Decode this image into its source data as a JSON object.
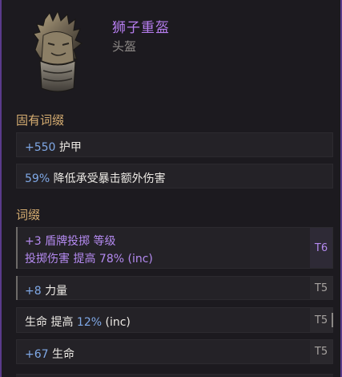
{
  "item": {
    "name": "狮子重盔",
    "type": "头盔",
    "icon": "lion-helmet-icon"
  },
  "implicit_section": {
    "title": "固有词缀",
    "rows": [
      {
        "num": "+550",
        "text": " 护甲"
      },
      {
        "num": "59%",
        "text": " 降低承受暴击额外伤害"
      }
    ]
  },
  "affix_section": {
    "title": "词缀",
    "rows": [
      {
        "line1": "+3 盾牌投掷 等级",
        "line2_a": "投掷伤害 提高 ",
        "line2_num": "78%",
        "line2_b": " (inc)",
        "tier": "T6"
      },
      {
        "num": "+8",
        "text": " 力量",
        "tier": "T5"
      },
      {
        "text_a": "生命 提高 ",
        "num": "12%",
        "text_b": " (inc)",
        "tier": "T5"
      },
      {
        "num": "+67",
        "text": " 生命",
        "tier": "T5"
      }
    ]
  },
  "colors": {
    "item_name": "#b77ef0",
    "section_title": "#d7ae72",
    "number": "#7fa8e6",
    "border_accent": "#5a3a8a"
  }
}
